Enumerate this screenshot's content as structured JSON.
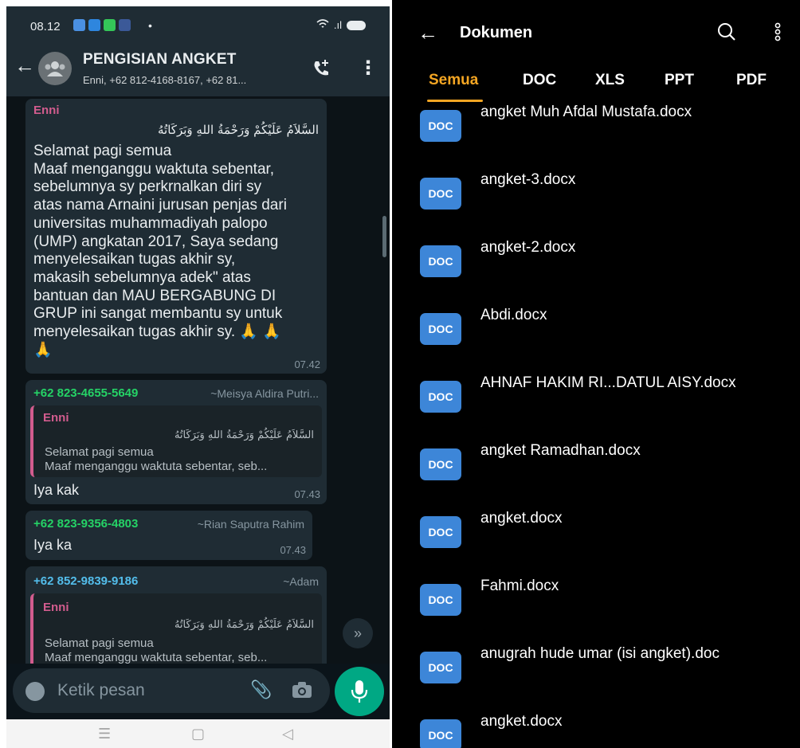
{
  "whatsapp": {
    "status_bar": {
      "time": "08.12",
      "dot": "•",
      "signal": ".ıl"
    },
    "header": {
      "title": "PENGISIAN ANGKET",
      "members": "Enni, +62 812-4168-8167, +62 81..."
    },
    "messages": [
      {
        "sender": "Enni",
        "arabic": "السَّلاَمُ عَلَيْكُمْ وَرَحْمَةُ اللهِ وَبَرَكَاتُهُ",
        "lines": [
          "Selamat pagi semua",
          "Maaf menganggu waktuta sebentar,",
          "sebelumnya sy perkrnalkan diri sy",
          "atas nama Arnaini jurusan penjas dari",
          "universitas muhammadiyah palopo",
          "(UMP) angkatan 2017, Saya sedang",
          "menyelesaikan tugas akhir sy,",
          "makasih sebelumnya adek\" atas",
          "bantuan dan MAU BERGABUNG DI",
          "GRUP ini sangat membantu sy untuk",
          "menyelesaikan tugas akhir sy. 🙏 🙏",
          "🙏"
        ],
        "time": "07.42"
      },
      {
        "sender": "+62 823-4655-5649",
        "push_name": "~Meisya Aldira Putri...",
        "quote": {
          "name": "Enni",
          "arabic": "السَّلاَمُ عَلَيْكُمْ وَرَحْمَةُ اللهِ وَبَرَكَاتُهُ",
          "line1": "Selamat pagi semua",
          "line2": "Maaf menganggu waktuta sebentar, seb..."
        },
        "text": "Iya kak",
        "time": "07.43"
      },
      {
        "sender": "+62 823-9356-4803",
        "push_name": "~Rian Saputra Rahim",
        "text": "Iya ka",
        "time": "07.43"
      },
      {
        "sender": "+62 852-9839-9186",
        "push_name": "~Adam",
        "quote": {
          "name": "Enni",
          "arabic": "السَّلاَمُ عَلَيْكُمْ وَرَحْمَةُ اللهِ وَبَرَكَاتُهُ",
          "line1": "Selamat pagi semua",
          "line2": "Maaf menganggu waktuta sebentar, seb..."
        }
      }
    ],
    "input": {
      "placeholder": "Ketik pesan"
    },
    "colors": {
      "header_bg": "#1f2c34",
      "chat_bg": "#0c1317",
      "bubble_bg": "#1f2c34",
      "accent": "#00a884",
      "sender_enni": "#d25c8e",
      "sender_green": "#53bdeb"
    }
  },
  "documents": {
    "header": {
      "title": "Dokumen"
    },
    "tabs": [
      "Semua",
      "DOC",
      "XLS",
      "PPT",
      "PDF"
    ],
    "active_tab": "Semua",
    "icon_label": "DOC",
    "files": [
      "angket Muh Afdal Mustafa.docx",
      "angket-3.docx",
      "angket-2.docx",
      "Abdi.docx",
      "AHNAF HAKIM RI...DATUL AISY.docx",
      "angket Ramadhan.docx",
      "angket.docx",
      "Fahmi.docx",
      "anugrah hude umar (isi angket).doc",
      "angket.docx"
    ],
    "colors": {
      "background": "#000000",
      "active_tab": "#f5a623",
      "doc_icon": "#3d86d8"
    }
  }
}
